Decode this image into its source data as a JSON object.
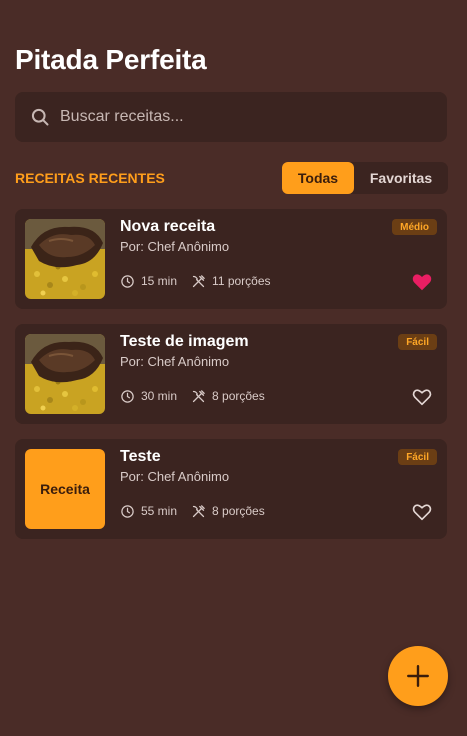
{
  "app": {
    "title": "Pitada Perfeita"
  },
  "search": {
    "placeholder": "Buscar receitas...",
    "icon": "search-icon"
  },
  "section": {
    "title": "RECEITAS RECENTES"
  },
  "filters": {
    "all_label": "Todas",
    "favorites_label": "Favoritas",
    "selected": "Todas"
  },
  "recipes": [
    {
      "title": "Nova receita",
      "author": "Por: Chef Anônimo",
      "time": "15 min",
      "servings": "11 porções",
      "difficulty": "Médio",
      "favorite": true,
      "image": "photo"
    },
    {
      "title": "Teste de imagem",
      "author": "Por: Chef Anônimo",
      "time": "30 min",
      "servings": "8 porções",
      "difficulty": "Fácil",
      "favorite": false,
      "image": "photo"
    },
    {
      "title": "Teste",
      "author": "Por: Chef Anônimo",
      "time": "55 min",
      "servings": "8 porções",
      "difficulty": "Fácil",
      "favorite": false,
      "image": "placeholder",
      "placeholder_text": "Receita"
    }
  ],
  "fab": {
    "icon": "plus-icon"
  },
  "colors": {
    "background": "#4a2c27",
    "card": "#3b2420",
    "accent": "#ff9e1b",
    "favorite": "#e91e63"
  }
}
